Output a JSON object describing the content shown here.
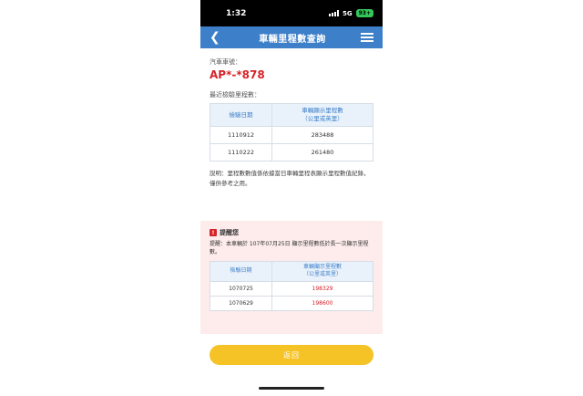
{
  "status_bar": {
    "time": "1:32",
    "network": "5G",
    "battery": "93+"
  },
  "nav": {
    "title": "車輛里程數查詢"
  },
  "vehicle": {
    "label": "汽車車號：",
    "plate": "AP*-*878"
  },
  "recent": {
    "label": "最近檢驗里程數：",
    "headers": [
      "檢驗日期",
      "車輛顯示里程數\n（公里或英里）"
    ],
    "rows": [
      {
        "date": "1110912",
        "mileage": "283488"
      },
      {
        "date": "1110222",
        "mileage": "261480"
      }
    ]
  },
  "note": "說明：里程數數值係依據當日車輛里程表顯示里程數值紀錄，僅供參考之用。",
  "alert": {
    "title": "提醒您",
    "text": "提醒：本車輛於 107年07月25日 顯示里程數低於長一次顯示里程數。",
    "headers": [
      "檢驗日期",
      "車輛顯示里程數\n（公里或英里）"
    ],
    "rows": [
      {
        "date": "1070725",
        "mileage": "198329"
      },
      {
        "date": "1070629",
        "mileage": "198600"
      }
    ]
  },
  "buttons": {
    "return_label": "返回"
  }
}
